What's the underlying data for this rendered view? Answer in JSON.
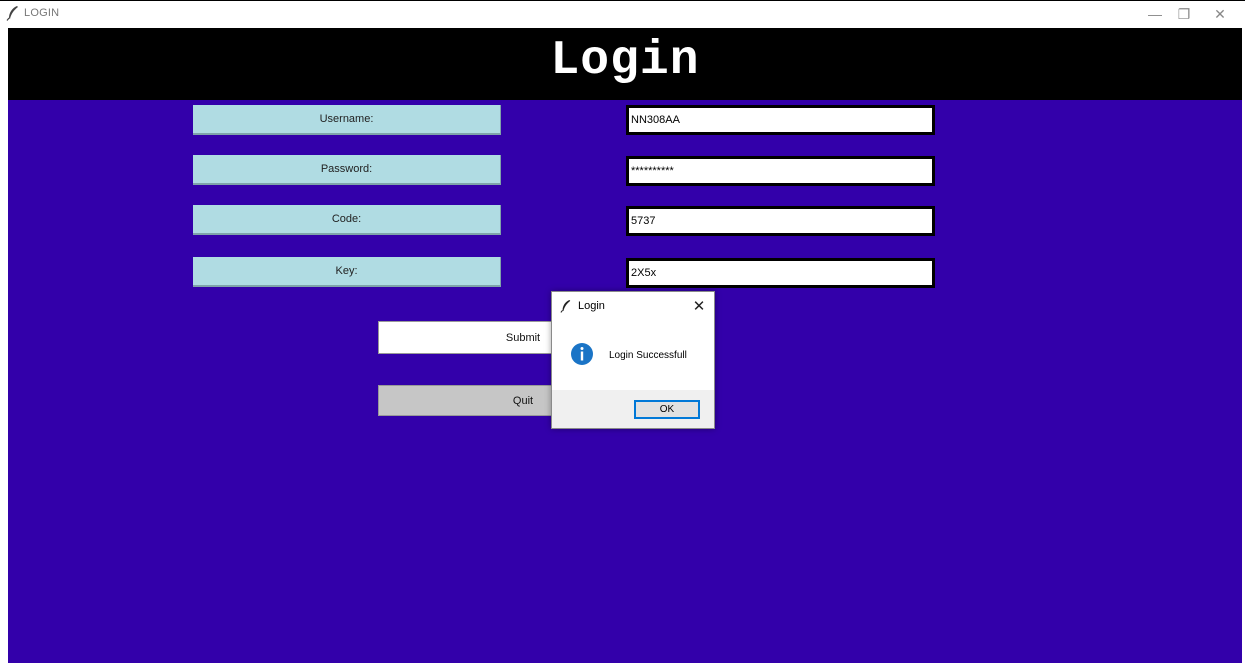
{
  "window": {
    "title": "LOGIN",
    "controls": {
      "minimize": "—",
      "maximize": "❐",
      "close": "✕"
    }
  },
  "header": {
    "title": "Login"
  },
  "form": {
    "username": {
      "label": "Username:",
      "value": "NN308AA"
    },
    "password": {
      "label": "Password:",
      "value": "**********"
    },
    "code": {
      "label": "Code:",
      "value": "5737"
    },
    "key": {
      "label": "Key:",
      "value": "2X5x"
    }
  },
  "buttons": {
    "submit": "Submit",
    "quit": "Quit"
  },
  "dialog": {
    "title": "Login",
    "close": "✕",
    "message": "Login Successfull",
    "ok": "OK"
  },
  "colors": {
    "background": "#3300aa",
    "header": "#000000",
    "label_fill": "#b0dce3",
    "info_icon": "#1a74c6",
    "ok_border": "#0078d7"
  },
  "icons": [
    "feather-icon",
    "info-icon",
    "close-icon"
  ]
}
